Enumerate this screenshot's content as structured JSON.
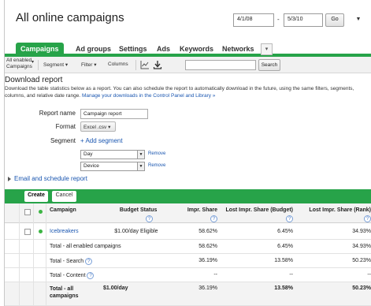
{
  "header": {
    "title": "All online campaigns",
    "date_start": "4/1/08",
    "date_sep": "-",
    "date_end": "5/3/10",
    "go_label": "Go",
    "menu_label": "▼"
  },
  "tabs": [
    {
      "label": "Campaigns",
      "active": true
    },
    {
      "label": "Ad groups",
      "active": false
    },
    {
      "label": "Settings",
      "active": false
    },
    {
      "label": "Ads",
      "active": false
    },
    {
      "label": "Keywords",
      "active": false
    },
    {
      "label": "Networks",
      "active": false
    }
  ],
  "tab_more_label": "▾",
  "toolbar": {
    "status_line1": "All enabled",
    "status_line2": "Campaigns",
    "segment_label": "Segment",
    "filter_label": "Filter",
    "columns_label": "Columns",
    "search_placeholder": "",
    "search_label": "Search"
  },
  "download": {
    "title": "Download report",
    "desc": "Download the table statistics below as a report. You can also schedule the report to automatically download in the future, using the same filters, segments, columns, and relative date range.",
    "desc_link": "Manage your downloads in the Control Panel and Library »",
    "report_name_label": "Report name",
    "report_name_value": "Campaign report",
    "format_label": "Format",
    "format_value": "Excel .csv",
    "segment_label": "Segment",
    "add_segment": "+ Add segment",
    "segments": [
      {
        "value": "Day",
        "remove": "Remove"
      },
      {
        "value": "Device",
        "remove": "Remove"
      }
    ],
    "email_link": "Email and schedule report"
  },
  "actions": {
    "create": "Create",
    "cancel": "Cancel"
  },
  "table": {
    "columns": {
      "campaign": "Campaign",
      "budget": "Budget",
      "status": "Status",
      "impr_share": "Impr. Share",
      "lost_budget": "Lost Impr. Share (Budget)",
      "lost_rank": "Lost Impr. Share (Rank)"
    },
    "help_glyph": "?",
    "rows": [
      {
        "campaign": "Icebreakers",
        "budget": "$1.00/day",
        "status": "Eligible",
        "impr_share": "58.62%",
        "lost_budget": "6.45%",
        "lost_rank": "34.93%"
      }
    ],
    "totals": [
      {
        "label": "Total - all enabled campaigns",
        "budget": "",
        "impr_share": "58.62%",
        "lost_budget": "6.45%",
        "lost_rank": "34.93%",
        "help": false
      },
      {
        "label": "Total - Search",
        "budget": "",
        "impr_share": "36.19%",
        "lost_budget": "13.58%",
        "lost_rank": "50.23%",
        "help": true
      },
      {
        "label": "Total - Content",
        "budget": "",
        "impr_share": "--",
        "lost_budget": "--",
        "lost_rank": "--",
        "help": true
      }
    ],
    "grand_total": {
      "label_line1": "Total - all",
      "label_line2": "campaigns",
      "budget": "$1.00/day",
      "impr_share": "36.19%",
      "lost_budget": "13.58%",
      "lost_rank": "50.23%"
    }
  },
  "colors": {
    "accent_green": "#27a349",
    "link_blue": "#1a56b0",
    "status_dot": "#3db544"
  }
}
